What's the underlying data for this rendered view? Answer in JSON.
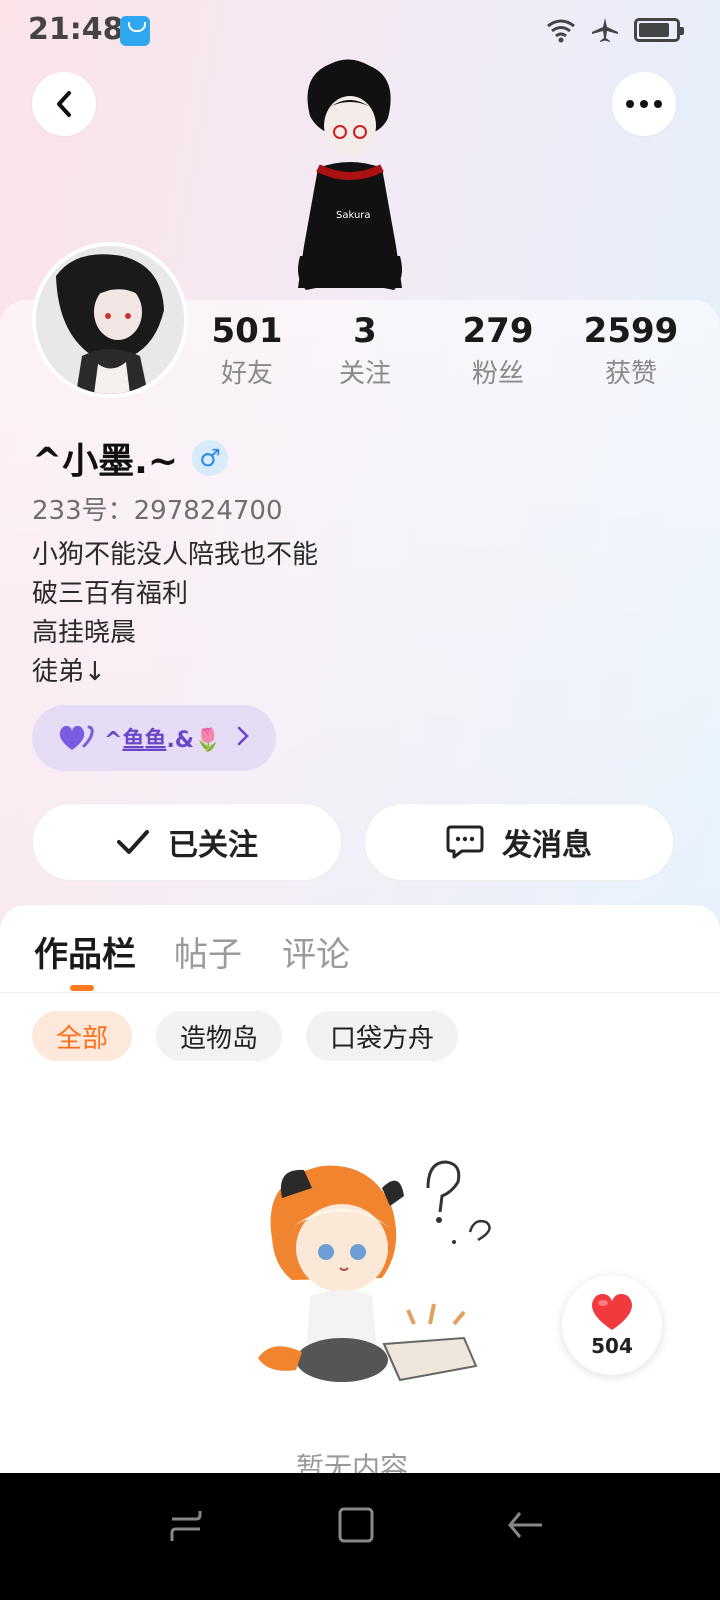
{
  "status_bar": {
    "time": "21:48"
  },
  "profile": {
    "stats": [
      {
        "value": "501",
        "label": "好友"
      },
      {
        "value": "3",
        "label": "关注"
      },
      {
        "value": "279",
        "label": "粉丝"
      },
      {
        "value": "2599",
        "label": "获赞"
      }
    ],
    "username": "^小墨.~",
    "gender_symbol": "♂",
    "user_id": "233号：297824700",
    "bio": [
      "小狗不能没人陪我也不能",
      "破三百有福利",
      "高挂晓晨",
      "徒弟↓"
    ],
    "relation": {
      "prefix": "^",
      "name": "鱼鱼",
      "suffix": ".&",
      "emoji": "🌷"
    }
  },
  "actions": {
    "follow_label": "已关注",
    "message_label": "发消息"
  },
  "tabs": [
    "作品栏",
    "帖子",
    "评论"
  ],
  "filters": [
    "全部",
    "造物岛",
    "口袋方舟"
  ],
  "empty_text": "暂无内容",
  "like_float": {
    "count": "504"
  },
  "colors": {
    "accent": "#ff7a1f",
    "relation": "#6a47c9",
    "gender": "#2f8be0"
  }
}
